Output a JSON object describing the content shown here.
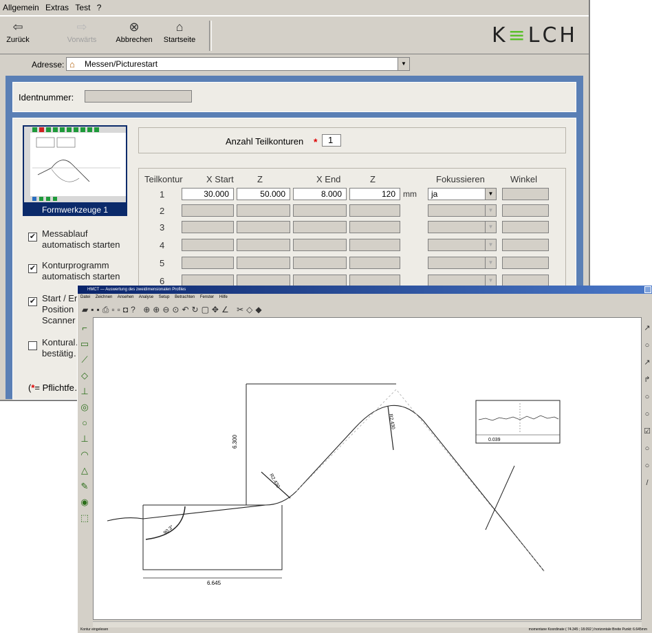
{
  "menu": [
    "Allgemein",
    "Extras",
    "Test",
    "?"
  ],
  "toolbar": {
    "back": {
      "label": "Zurück",
      "icon": "arrow-left-icon"
    },
    "forward": {
      "label": "Vorwärts",
      "icon": "arrow-right-icon"
    },
    "cancel": {
      "label": "Abbrechen",
      "icon": "stop-icon"
    },
    "home": {
      "label": "Startseite",
      "icon": "home-icon"
    }
  },
  "brand": {
    "prefix": "K",
    "accent": "≡",
    "suffix": "LCH",
    "accent_color": "#5bbf2a"
  },
  "address": {
    "label": "Adresse:",
    "value": "Messen/Picturestart"
  },
  "ident": {
    "label": "Identnummer:",
    "value": ""
  },
  "program": {
    "thumbnail_caption": "Formwerkzeuge 1"
  },
  "checkboxes": [
    {
      "label": "Messablauf automatisch starten",
      "checked": true,
      "mark": "✔"
    },
    {
      "label": "Konturprogramm automatisch starten",
      "checked": true,
      "mark": "✔"
    },
    {
      "label": "Start / En… Position Scanner",
      "checked": true,
      "mark": "✔"
    },
    {
      "label": "Kontural… bestätig…",
      "checked": false,
      "mark": ""
    }
  ],
  "legend": {
    "star": "*",
    "text": "= Pflichtfe…",
    "open": "("
  },
  "anzahl": {
    "label": "Anzahl Teilkonturen",
    "value": "1"
  },
  "grid": {
    "headers": {
      "teilkontur": "Teilkontur",
      "x_start": "X  Start",
      "z_start": "Z",
      "x_end": "X   End",
      "z_end": "Z",
      "fokus": "Fokussieren",
      "winkel": "Winkel"
    },
    "unit": "mm",
    "rows": [
      {
        "n": "1",
        "x_start": "30.000",
        "z_start": "50.000",
        "x_end": "8.000",
        "z_end": "120",
        "fokus": "ja"
      },
      {
        "n": "2",
        "x_start": "",
        "z_start": "",
        "x_end": "",
        "z_end": "",
        "fokus": ""
      },
      {
        "n": "3",
        "x_start": "",
        "z_start": "",
        "x_end": "",
        "z_end": "",
        "fokus": ""
      },
      {
        "n": "4",
        "x_start": "",
        "z_start": "",
        "x_end": "",
        "z_end": "",
        "fokus": ""
      },
      {
        "n": "5",
        "x_start": "",
        "z_start": "",
        "x_end": "",
        "z_end": "",
        "fokus": ""
      },
      {
        "n": "6",
        "x_start": "",
        "z_start": "",
        "x_end": "",
        "z_end": "",
        "fokus": ""
      }
    ]
  },
  "analysis": {
    "title": "HMCT — Auswertung des zweidimensionalen Profiles",
    "menu": [
      "Datei",
      "Zeichnen",
      "Ansehen",
      "Analyse",
      "Setup",
      "Betrachten",
      "Fenster",
      "Hilfe"
    ],
    "dimensions": {
      "height": "6.300",
      "width": "6.645",
      "radius1": "R2.430",
      "radius2": "R2.430",
      "angle": "90.3°"
    },
    "inset_value": "0.039",
    "status_left": "Kontur eingelesen",
    "status_right": "momentane Koordinate ( 74.345 ; 18.092 )  horizontale Breite Punkt: 6.645mm"
  }
}
